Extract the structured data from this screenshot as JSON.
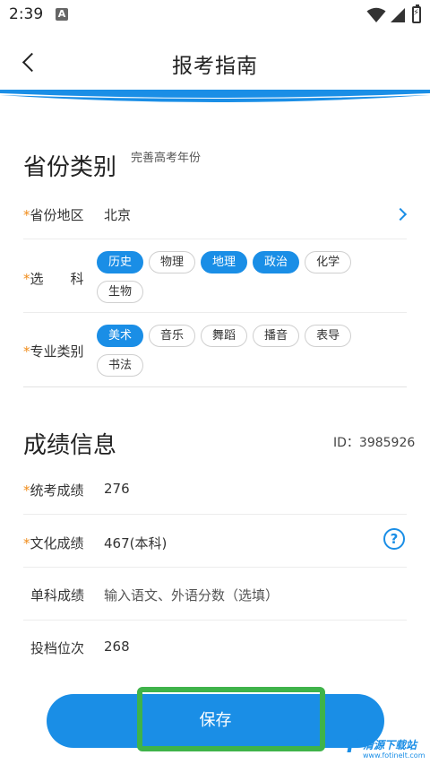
{
  "status_bar": {
    "time": "2:39",
    "notification_icon": "A"
  },
  "header": {
    "title": "报考指南"
  },
  "province_section": {
    "title": "省份类别",
    "hint": "完善高考年份",
    "region": {
      "required": "*",
      "label": "省份地区",
      "value": "北京"
    },
    "subjects": {
      "required": "*",
      "label": "选　　科",
      "options": [
        {
          "label": "历史",
          "selected": true
        },
        {
          "label": "物理",
          "selected": false
        },
        {
          "label": "地理",
          "selected": true
        },
        {
          "label": "政治",
          "selected": true
        },
        {
          "label": "化学",
          "selected": false
        },
        {
          "label": "生物",
          "selected": false
        }
      ]
    },
    "major_type": {
      "required": "*",
      "label": "专业类别",
      "options": [
        {
          "label": "美术",
          "selected": true
        },
        {
          "label": "音乐",
          "selected": false
        },
        {
          "label": "舞蹈",
          "selected": false
        },
        {
          "label": "播音",
          "selected": false
        },
        {
          "label": "表导",
          "selected": false
        },
        {
          "label": "书法",
          "selected": false
        }
      ]
    }
  },
  "score_section": {
    "title": "成绩信息",
    "id_text": "ID：3985926",
    "unified_score": {
      "required": "*",
      "label": "统考成绩",
      "value": "276"
    },
    "culture_score": {
      "required": "*",
      "label": "文化成绩",
      "value": "467(本科)",
      "help": "?"
    },
    "single_score": {
      "label": "单科成绩",
      "placeholder": "输入语文、外语分数（选填）"
    },
    "rank": {
      "label": "投档位次",
      "value": "268"
    }
  },
  "save_button": {
    "label": "保存"
  },
  "watermark": {
    "mark": "Y",
    "name": "清源下载站",
    "url": "www.fotinelt.com"
  },
  "colors": {
    "accent": "#1a8ee6",
    "required": "#f08c1a",
    "highlight": "#3fb34a"
  }
}
